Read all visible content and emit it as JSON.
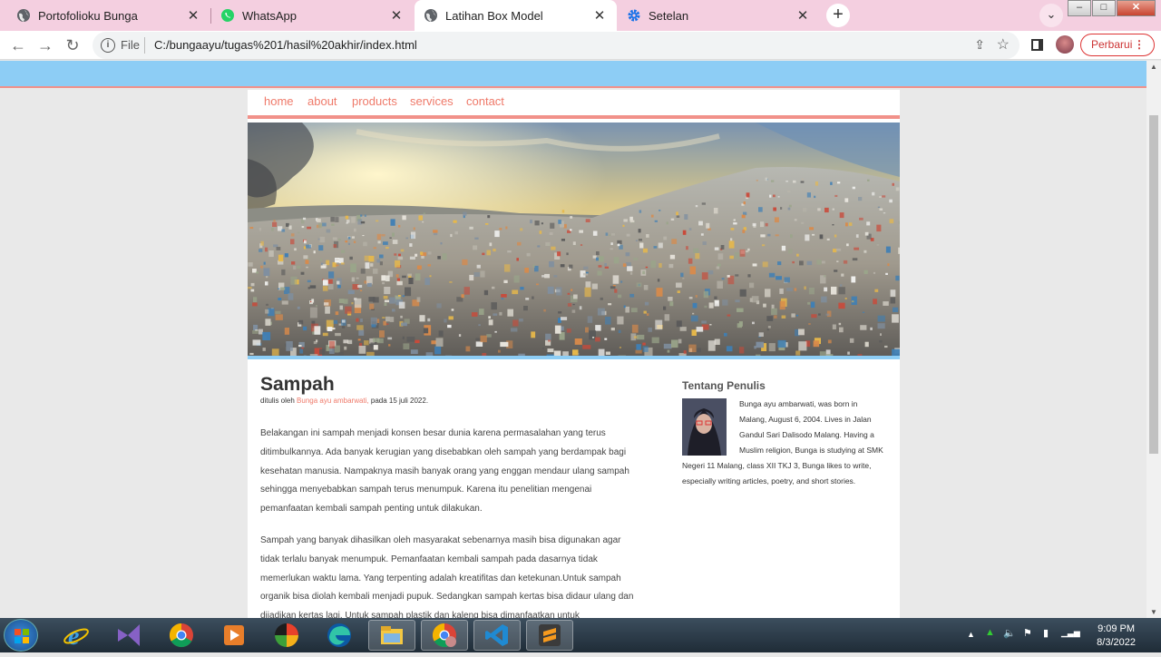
{
  "browser": {
    "tabs": [
      {
        "title": "Portofolioku Bunga",
        "icon": "globe-icon",
        "active": false
      },
      {
        "title": "WhatsApp",
        "icon": "whatsapp-icon",
        "active": false
      },
      {
        "title": "Latihan Box Model",
        "icon": "globe-icon",
        "active": true
      },
      {
        "title": "Setelan",
        "icon": "gear-icon",
        "active": false
      }
    ],
    "new_tab": "+",
    "close_glyph": "✕",
    "address": {
      "scheme_label": "File",
      "url": "C:/bungaayu/tugas%201/hasil%20akhir/index.html"
    },
    "update_button": "Perbarui"
  },
  "page": {
    "menu": [
      "home",
      "about",
      "products",
      "services",
      "contact"
    ],
    "article": {
      "title": "Sampah",
      "meta_prefix": "ditulis oleh",
      "author": "Bunga ayu ambarwati,",
      "meta_suffix": "pada 15 juli 2022.",
      "paragraphs": [
        "Belakangan ini sampah menjadi konsen besar dunia karena permasalahan yang terus ditimbulkannya. Ada banyak kerugian yang disebabkan oleh sampah yang berdampak bagi kesehatan manusia. Nampaknya masih banyak orang yang enggan mendaur ulang sampah sehingga menyebabkan sampah terus menumpuk. Karena itu penelitian mengenai pemanfaatan kembali sampah penting untuk dilakukan.",
        "Sampah yang banyak dihasilkan oleh masyarakat sebenarnya masih bisa digunakan agar tidak terlalu banyak menumpuk. Pemanfaatan kembali sampah pada dasarnya tidak memerlukan waktu lama. Yang terpenting adalah kreatifitas dan ketekunan.Untuk sampah organik bisa diolah kembali menjadi pupuk. Sedangkan sampah kertas bisa didaur ulang dan dijadikan kertas lagi. Untuk sampah plastik dan kaleng bisa dimanfaatkan untuk"
      ]
    },
    "aside": {
      "heading": "Tentang Penulis",
      "bio": "Bunga ayu ambarwati, was born in Malang, August 6, 2004. Lives in Jalan Gandul Sari Dalisodo Malang. Having a Muslim religion, Bunga is studying at SMK Negeri 11 Malang, class XII TKJ 3, Bunga likes to write, especially writing articles, poetry, and short stories."
    }
  },
  "taskbar": {
    "apps": [
      "internet-explorer-icon",
      "visual-studio-icon",
      "chrome-icon",
      "media-player-icon",
      "krita-icon",
      "edge-icon",
      "file-explorer-icon",
      "chrome-icon",
      "vscode-icon",
      "sublime-icon"
    ],
    "time": "9:09 PM",
    "date": "8/3/2022"
  },
  "colors": {
    "accent": "#f1918a",
    "band": "#8dcdf5",
    "link": "#ef7a6a",
    "tabbar": "#f4cfe0"
  }
}
